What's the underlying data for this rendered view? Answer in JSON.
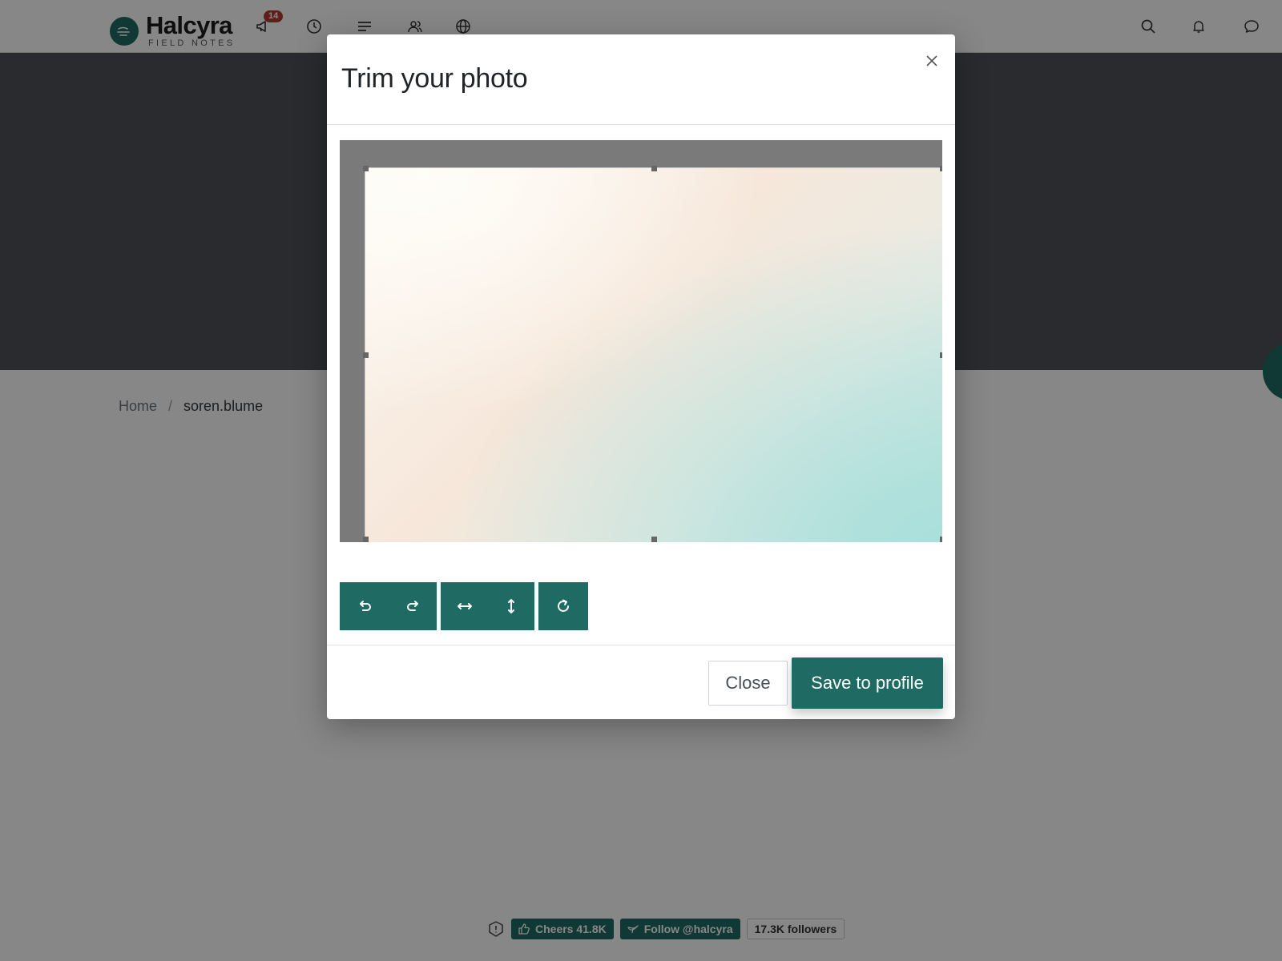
{
  "topnav": {
    "brand_name": "Halcyra",
    "brand_tagline": "FIELD NOTES",
    "notification_count": "14",
    "left_icons": [
      "megaphone-icon",
      "clock-icon",
      "list-icon",
      "people-icon",
      "globe-icon"
    ],
    "right_icons": [
      "search-icon",
      "bell-icon",
      "chat-icon"
    ]
  },
  "breadcrumb": {
    "home": "Home",
    "separator": "/",
    "current": "soren.blume"
  },
  "modal": {
    "title": "Trim your photo",
    "toolbar": {
      "buttons": [
        "rotate-left-icon",
        "rotate-right-icon",
        "flip-horizontal-icon",
        "flip-vertical-icon",
        "reset-icon"
      ]
    },
    "close_label": "Close",
    "save_label": "Save to profile"
  },
  "footer": {
    "cheers_label": "Cheers 41.8K",
    "follow_label": "Follow @halcyra",
    "followers_label": "17.3K followers"
  },
  "colors": {
    "accent": "#1f6b63",
    "badge": "#b33a2e",
    "backdrop": "rgba(0,0,0,0.47)"
  }
}
